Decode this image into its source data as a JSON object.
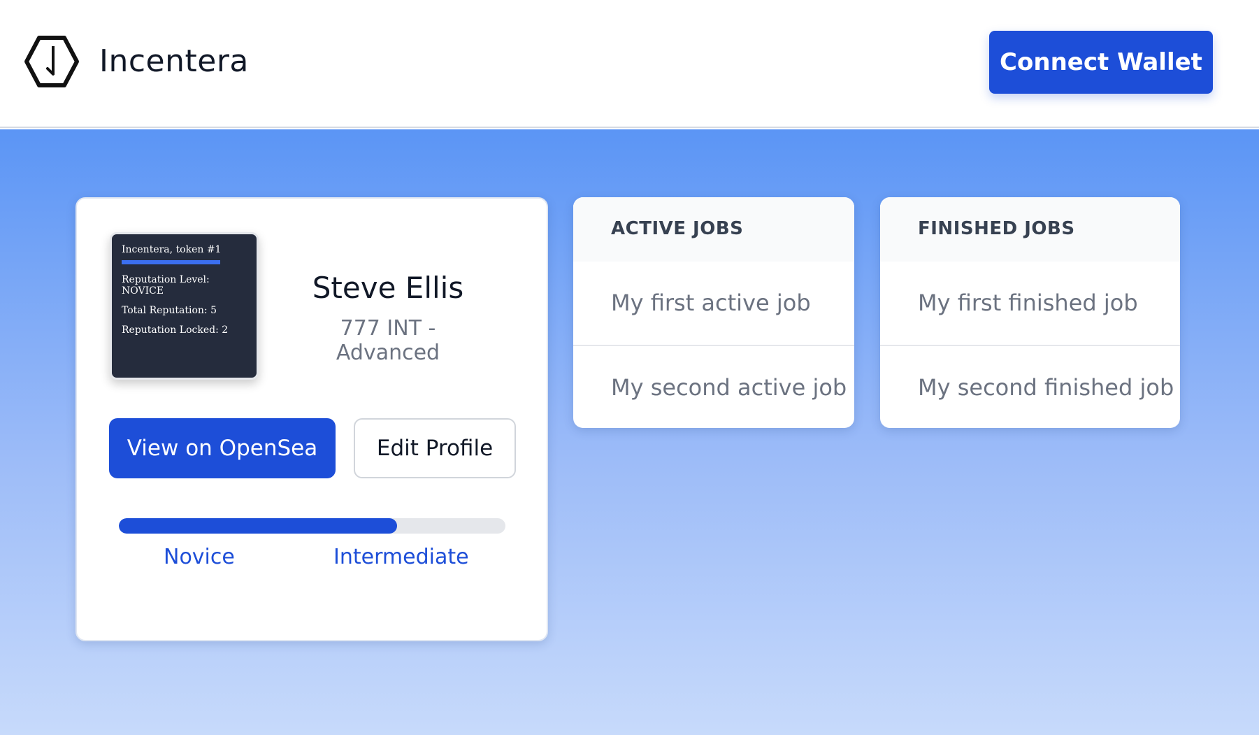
{
  "header": {
    "brand": "Incentera",
    "connect_label": "Connect Wallet"
  },
  "profile": {
    "nft": {
      "title": "Incentera, token #1",
      "lines": [
        "Reputation Level: NOVICE",
        "Total Reputation: 5",
        "Reputation Locked: 2"
      ]
    },
    "name": "Steve Ellis",
    "subtitle": "777 INT - Advanced",
    "opensea_label": "View on OpenSea",
    "edit_label": "Edit Profile",
    "progress": {
      "fraction": 0.72,
      "current_level": "Novice",
      "next_level": "Intermediate"
    }
  },
  "active_jobs": {
    "heading": "ACTIVE JOBS",
    "items": [
      "My first active job",
      "My second active job"
    ]
  },
  "finished_jobs": {
    "heading": "FINISHED JOBS",
    "items": [
      "My first finished job",
      "My second finished job"
    ]
  },
  "colors": {
    "primary": "#1d4ed8",
    "nft_bg": "#252c3d",
    "gradient_top": "#5b95f5",
    "gradient_bottom": "#c7dafb"
  },
  "icons": {
    "logo": "hexagon-logo-icon"
  }
}
